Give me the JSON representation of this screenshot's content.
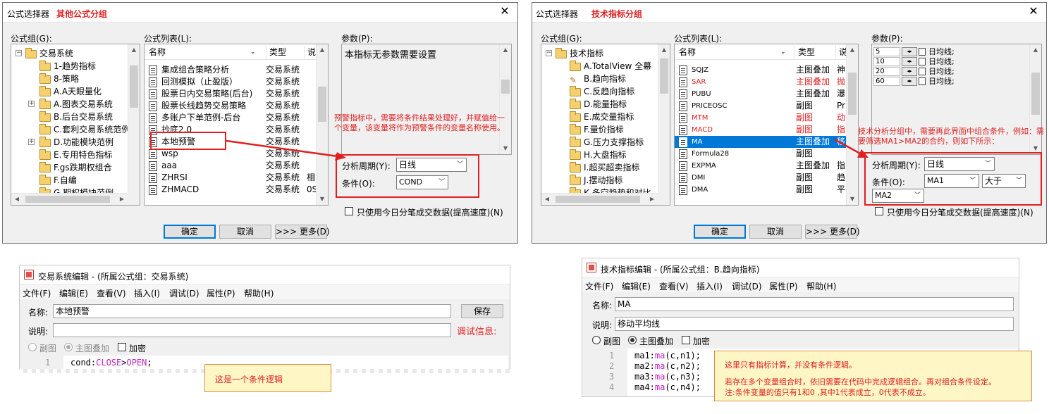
{
  "left": {
    "title": "公式选择器",
    "group_name": "其他公式分组",
    "group_label": "公式组(G):",
    "list_label": "公式列表(L):",
    "params_label": "参数(P):",
    "params_text": "本指标无参数需要设置",
    "tree": [
      "交易系统",
      "1-趋势指标",
      "8-策略",
      "A.A天眼量化",
      "A.图表交易系统",
      "B.后台交易系统",
      "C.套利交易系统范例",
      "D.功能模块范例",
      "E.专用特色指标",
      "F.gs跌期权组合",
      "F.自编",
      "G.期权模块范例"
    ],
    "col_name": "名称",
    "col_type": "类型",
    "col_desc": "说",
    "list": [
      {
        "name": "集成组合策略分析",
        "type": "交易系统",
        "x": ""
      },
      {
        "name": "回测模拟（止盈版）",
        "type": "交易系统",
        "x": ""
      },
      {
        "name": "股票日内交易策略(后台)",
        "type": "交易系统",
        "x": ""
      },
      {
        "name": "股票长线趋势交易策略",
        "type": "交易系统",
        "x": ""
      },
      {
        "name": "多账户下单范例-后台",
        "type": "交易系统",
        "x": ""
      },
      {
        "name": "抄底2.0",
        "type": "交易系统",
        "x": ""
      },
      {
        "name": "本地预警",
        "type": "交易系统",
        "x": ""
      },
      {
        "name": "wsp",
        "type": "交易系统",
        "x": ""
      },
      {
        "name": "aaa",
        "type": "交易系统",
        "x": ""
      },
      {
        "name": "ZHRSI",
        "type": "交易系统",
        "x": "相"
      },
      {
        "name": "ZHMACD",
        "type": "交易系统",
        "x": "0S"
      }
    ],
    "annotation": "预警指标中，需要将条件结果处理好，并赋值给一个变量，该变量将作为预警条件的变量名称使用。",
    "period_label": "分析周期(Y):",
    "period_value": "日线",
    "cond_label": "条件(O):",
    "cond_value": "COND",
    "tick_label": "只使用今日分笔成交数据(提高速度)(N)",
    "ok": "确定",
    "cancel": "取消",
    "more": ">>> 更多(D)"
  },
  "right": {
    "title": "公式选择器",
    "group_name": "技术指标分组",
    "group_label": "公式组(G):",
    "list_label": "公式列表(L):",
    "params_label": "参数(P):",
    "tree": [
      "技术指标",
      "A.TotalView 全幕",
      "B.趋向指标",
      "C.反趋向指标",
      "D.能量指标",
      "E.成交量指标",
      "F.量价指标",
      "G.压力支撑指标",
      "H.大盘指标",
      "I.超买超卖指标",
      "J.摆动指标",
      "K.多空趋势和对比"
    ],
    "col_name": "名称",
    "col_type": "类型",
    "col_desc": "说",
    "list": [
      {
        "name": "SQJZ",
        "type": "主图叠加",
        "x": "神",
        "red": false
      },
      {
        "name": "SAR",
        "type": "主图叠加",
        "x": "抛",
        "red": true
      },
      {
        "name": "PUBU",
        "type": "主图叠加",
        "x": "瀑",
        "red": false
      },
      {
        "name": "PRICEOSC",
        "type": "副图",
        "x": "Pr",
        "red": false
      },
      {
        "name": "MTM",
        "type": "副图",
        "x": "动",
        "red": true
      },
      {
        "name": "MACD",
        "type": "副图",
        "x": "指",
        "red": true
      },
      {
        "name": "MA",
        "type": "主图叠加",
        "x": "移",
        "red": false
      },
      {
        "name": "Formula28",
        "type": "副图",
        "x": "",
        "red": false
      },
      {
        "name": "EXPMA",
        "type": "主图叠加",
        "x": "指",
        "red": false
      },
      {
        "name": "DMI",
        "type": "副图",
        "x": "趋",
        "red": false
      },
      {
        "name": "DMA",
        "type": "副图",
        "x": "平",
        "red": false
      }
    ],
    "params": [
      {
        "value": "5",
        "label": "日均线;"
      },
      {
        "value": "10",
        "label": "日均线;"
      },
      {
        "value": "20",
        "label": "日均线;"
      },
      {
        "value": "60",
        "label": "日均线;"
      }
    ],
    "annotation": "技术分析分组中，需要再此界面中组合条件，例如：需要筛选MA1>MA2的合约，则如下所示：",
    "period_label": "分析周期(Y):",
    "period_value": "日线",
    "cond_label": "条件(O):",
    "cond_left": "MA1",
    "cond_op": "大于",
    "cond_right": "MA2",
    "tick_label": "只使用今日分笔成交数据(提高速度)(N)",
    "ok": "确定",
    "cancel": "取消",
    "more": ">>> 更多(D)"
  },
  "left_editor": {
    "title": "交易系统编辑 - (所属公式组：交易系统)",
    "menu": [
      "文件(F)",
      "编辑(E)",
      "查看(V)",
      "插入(I)",
      "调试(D)",
      "属性(P)",
      "帮助(H)"
    ],
    "name_label": "名称:",
    "name_value": "本地预警",
    "save": "保存",
    "desc_label": "说明:",
    "debug": "调试信息:",
    "sub_chart": "副图",
    "main_overlay": "主图叠加",
    "encrypt": "加密",
    "line_no": "1",
    "code_prefix": "cond:",
    "code_a": "CLOSE",
    "code_op": ">",
    "code_b": "OPEN",
    "code_end": ";",
    "note": "这是一个条件逻辑"
  },
  "right_editor": {
    "title": "技术指标编辑 - (所属公式组：B.趋向指标)",
    "menu": [
      "文件(F)",
      "编辑(E)",
      "查看(V)",
      "插入(I)",
      "调试(D)",
      "属性(P)",
      "帮助(H)"
    ],
    "name_label": "名称:",
    "name_value": "MA",
    "desc_label": "说明:",
    "desc_value": "移动平均线",
    "sub_chart": "副图",
    "main_overlay": "主图叠加",
    "encrypt": "加密",
    "code": [
      {
        "n": "1",
        "pre": "ma1:",
        "fn": "ma",
        "args": "(c,n1);"
      },
      {
        "n": "2",
        "pre": "ma2:",
        "fn": "ma",
        "args": "(c,n2);"
      },
      {
        "n": "3",
        "pre": "ma3:",
        "fn": "ma",
        "args": "(c,n3);"
      },
      {
        "n": "4",
        "pre": "ma4:",
        "fn": "ma",
        "args": "(c,n4);"
      }
    ],
    "note1": "这里只有指标计算，并没有条件逻辑。",
    "note2": "若存在多个变量组合时，依旧需要在代码中完成逻辑组合。再对组合条件设定。",
    "note3": "注:条件变量的值只有1和0 ,其中1代表成立，0代表不成立。"
  }
}
